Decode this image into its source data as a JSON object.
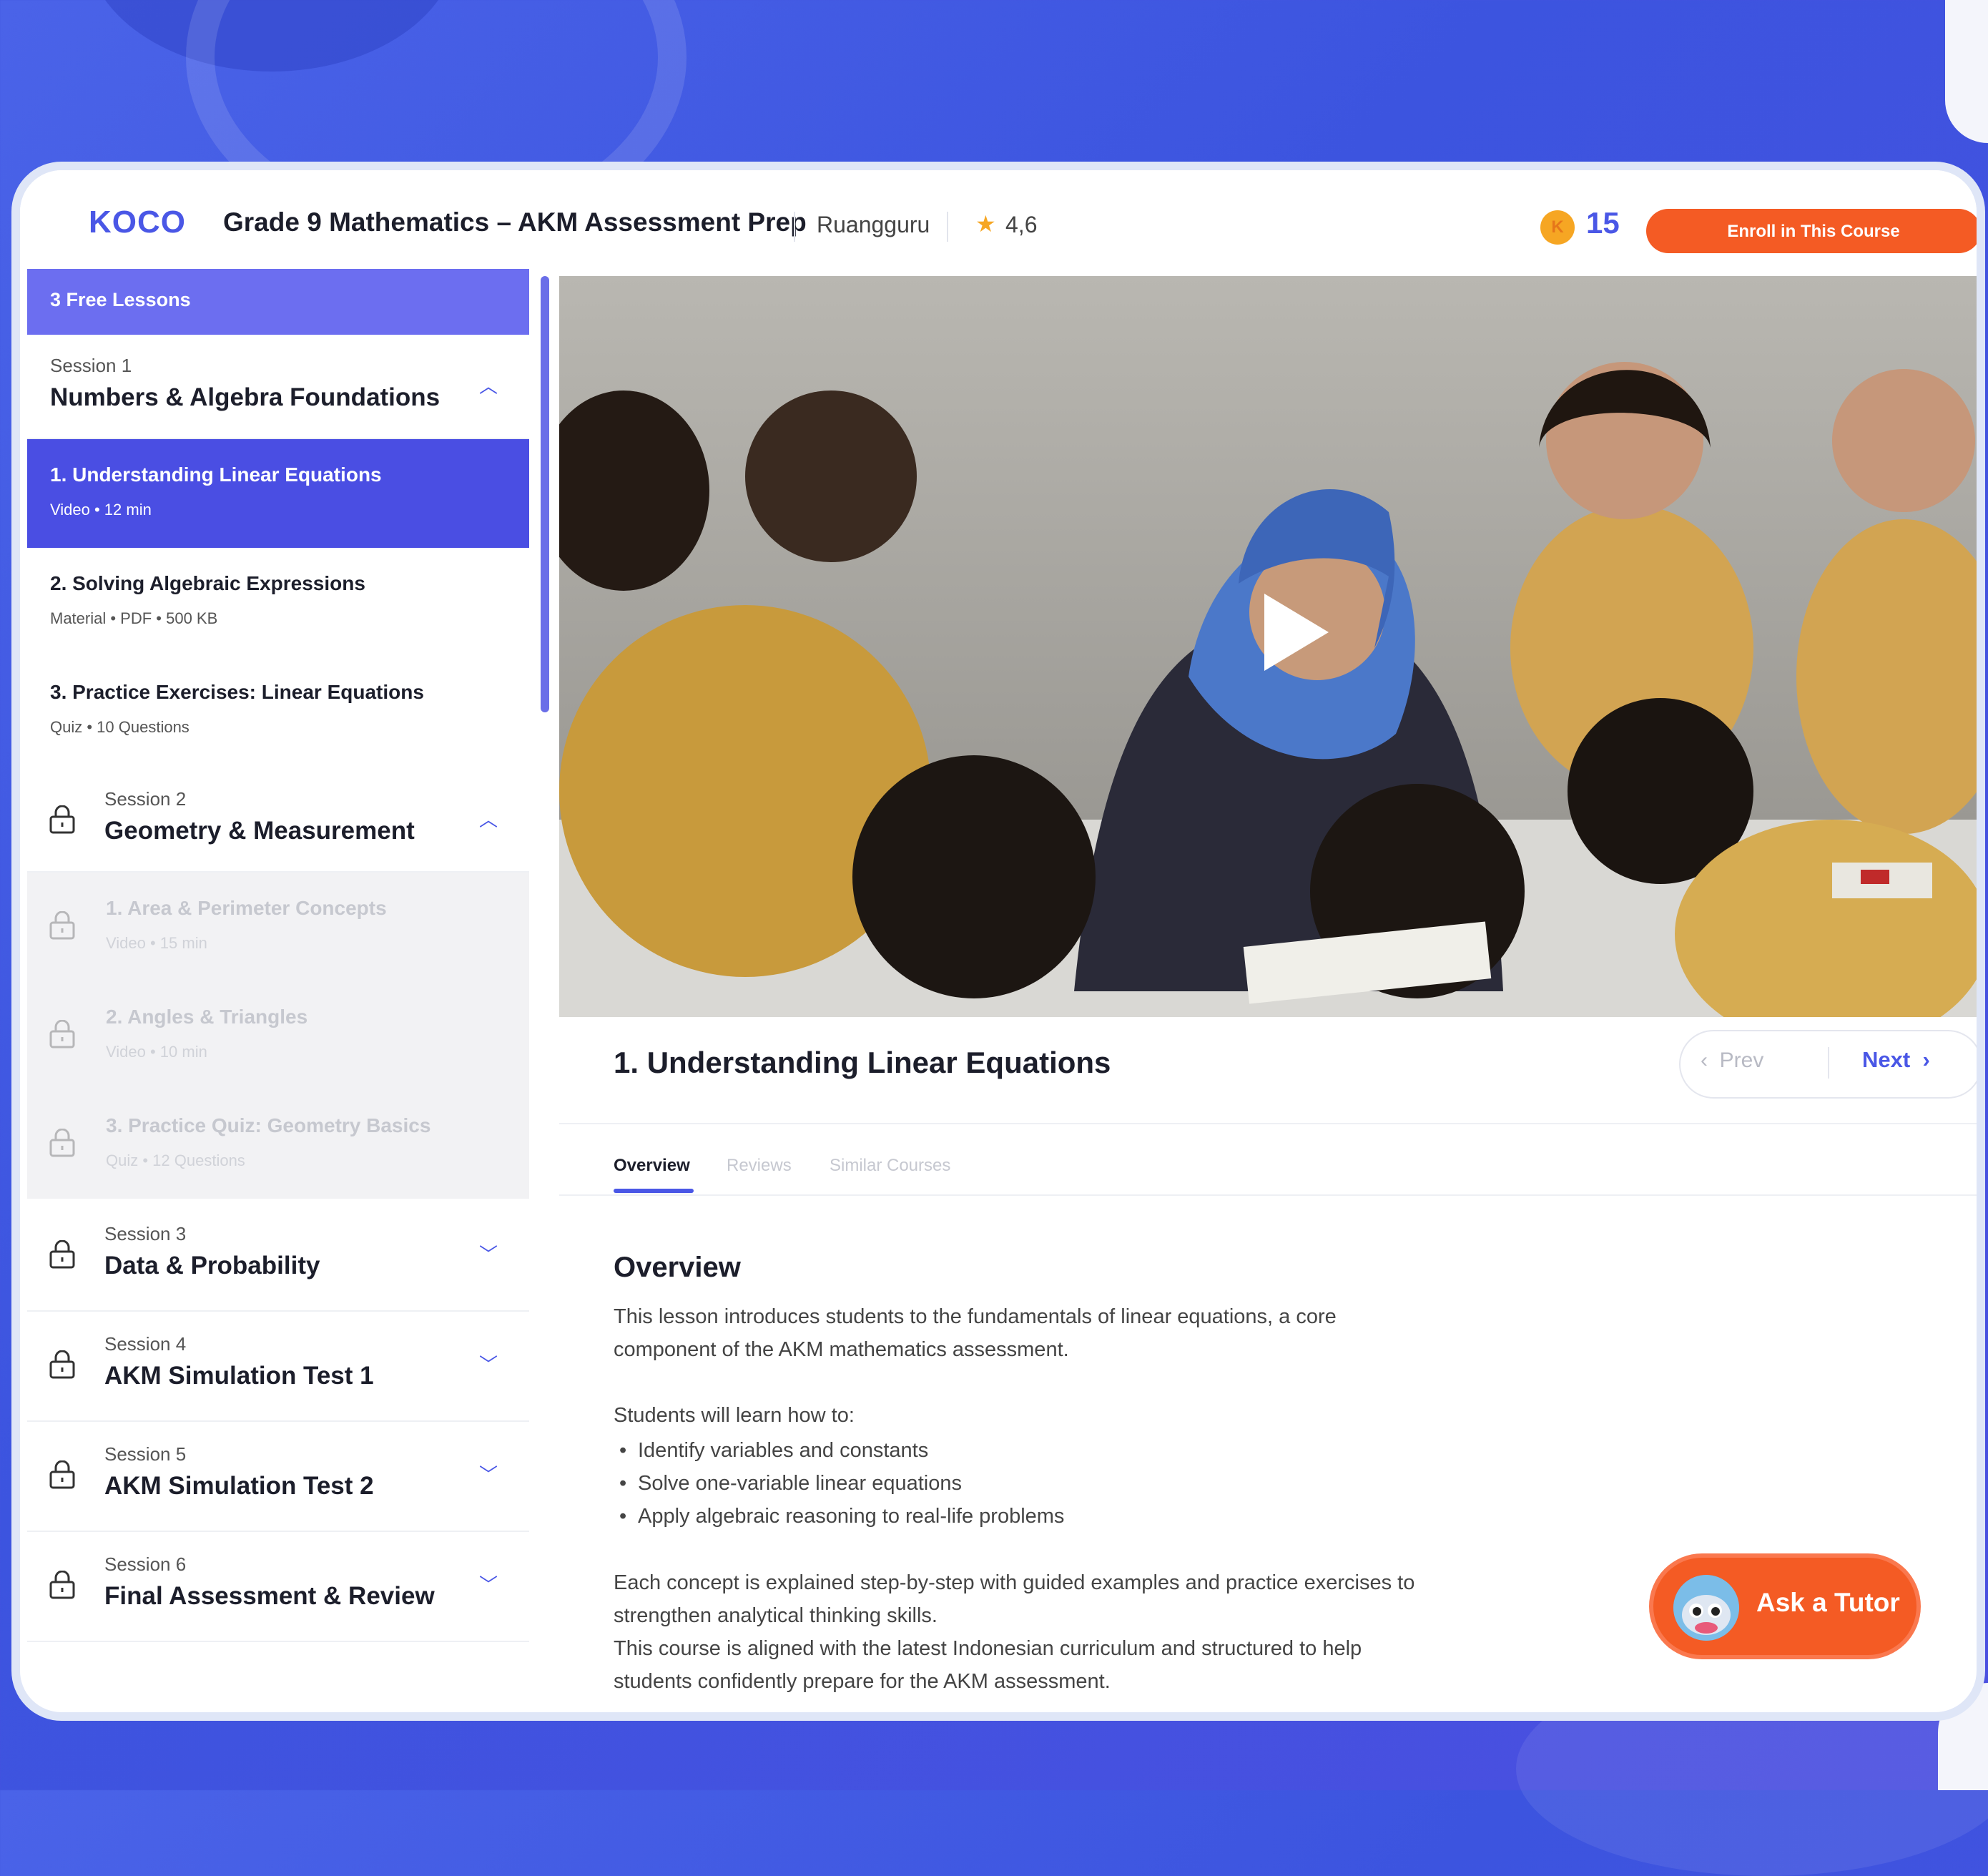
{
  "header": {
    "logo": "KOCO",
    "course_title": "Grade 9 Mathematics – AKM Assessment Prep",
    "provider": "Ruangguru",
    "rating": "4,6",
    "coin_letter": "K",
    "coins": "15",
    "enroll_label": "Enroll in This Course"
  },
  "sidebar": {
    "free_lessons_label": "3 Free Lessons",
    "sessions": [
      {
        "label": "Session 1",
        "title": "Numbers & Algebra Foundations",
        "expanded": true,
        "locked": false,
        "lessons": [
          {
            "title": "1. Understanding Linear Equations",
            "meta": "Video • 12 min",
            "active": true
          },
          {
            "title": "2. Solving Algebraic Expressions",
            "meta": "Material • PDF • 500 KB"
          },
          {
            "title": "3. Practice Exercises: Linear Equations",
            "meta": "Quiz • 10 Questions"
          }
        ]
      },
      {
        "label": "Session 2",
        "title": "Geometry & Measurement",
        "expanded": true,
        "locked": true,
        "lessons": [
          {
            "title": "1. Area & Perimeter Concepts",
            "meta": "Video • 15 min"
          },
          {
            "title": "2. Angles & Triangles",
            "meta": "Video • 10 min"
          },
          {
            "title": "3. Practice Quiz: Geometry Basics",
            "meta": "Quiz • 12 Questions"
          }
        ]
      },
      {
        "label": "Session 3",
        "title": "Data & Probability",
        "expanded": false,
        "locked": true
      },
      {
        "label": "Session 4",
        "title": "AKM Simulation Test 1",
        "expanded": false,
        "locked": true
      },
      {
        "label": "Session 5",
        "title": "AKM Simulation Test 2",
        "expanded": false,
        "locked": true
      },
      {
        "label": "Session 6",
        "title": "Final Assessment & Review",
        "expanded": false,
        "locked": true
      }
    ]
  },
  "main": {
    "lesson_heading": "1. Understanding Linear Equations",
    "prev_label": "Prev",
    "next_label": "Next",
    "tabs": [
      "Overview",
      "Reviews",
      "Similar Courses"
    ],
    "active_tab": "Overview",
    "overview_title": "Overview",
    "intro_line1": "This lesson introduces students to the fundamentals of linear equations, a core",
    "intro_line2": "component of the AKM mathematics assessment.",
    "learn_intro": "Students will learn how to:",
    "bullets": [
      "Identify variables and constants",
      "Solve one-variable linear equations",
      "Apply algebraic reasoning to real-life problems"
    ],
    "closing_line1": "Each concept is explained step-by-step with guided examples and practice exercises to",
    "closing_line2": "strengthen analytical thinking skills.",
    "closing_line3": "This course is aligned with the latest Indonesian curriculum and structured to help",
    "closing_line4": "students confidently prepare for the AKM assessment."
  },
  "tutor_button": {
    "label": "Ask a Tutor"
  },
  "colors": {
    "accent": "#4a57e6",
    "cta": "#f45b24",
    "active_lesson": "#4a4ee3",
    "free_header": "#6c6ef0"
  }
}
